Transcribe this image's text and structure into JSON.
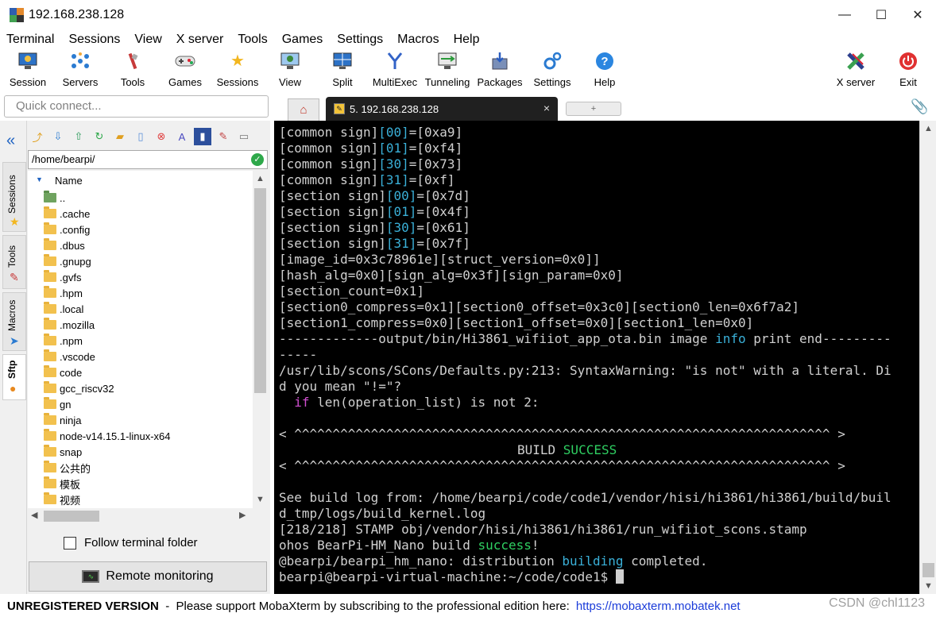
{
  "window": {
    "title": "192.168.238.128",
    "minimize": "—",
    "maximize": "☐",
    "close": "✕"
  },
  "menu": [
    "Terminal",
    "Sessions",
    "View",
    "X server",
    "Tools",
    "Games",
    "Settings",
    "Macros",
    "Help"
  ],
  "toolbar": {
    "session": "Session",
    "servers": "Servers",
    "tools": "Tools",
    "games": "Games",
    "sessions": "Sessions",
    "view": "View",
    "split": "Split",
    "multiexec": "MultiExec",
    "tunneling": "Tunneling",
    "packages": "Packages",
    "settings": "Settings",
    "help": "Help",
    "xserver": "X server",
    "exit": "Exit"
  },
  "quick_connect": {
    "placeholder": "Quick connect..."
  },
  "tabs": {
    "active_label": "5. 192.168.238.128",
    "close": "×",
    "new": "+"
  },
  "sidebar_tabs": {
    "sessions": "Sessions",
    "tools": "Tools",
    "macros": "Macros",
    "sftp": "Sftp"
  },
  "sftp": {
    "path": "/home/bearpi/",
    "column": "Name",
    "items": [
      "..",
      ".cache",
      ".config",
      ".dbus",
      ".gnupg",
      ".gvfs",
      ".hpm",
      ".local",
      ".mozilla",
      ".npm",
      ".vscode",
      "code",
      "gcc_riscv32",
      "gn",
      "ninja",
      "node-v14.15.1-linux-x64",
      "snap",
      "公共的",
      "模板",
      "视频"
    ],
    "follow_label": "Follow terminal folder",
    "remote_label": "Remote monitoring"
  },
  "terminal": {
    "lines": [
      [
        "[common sign]",
        "[00]",
        "=[0xa9]"
      ],
      [
        "[common sign]",
        "[01]",
        "=[0xf4]"
      ],
      [
        "[common sign]",
        "[30]",
        "=[0x73]"
      ],
      [
        "[common sign]",
        "[31]",
        "=[0xf]"
      ],
      [
        "[section sign]",
        "[00]",
        "=[0x7d]"
      ],
      [
        "[section sign]",
        "[01]",
        "=[0x4f]"
      ],
      [
        "[section sign]",
        "[30]",
        "=[0x61]"
      ],
      [
        "[section sign]",
        "[31]",
        "=[0x7f]"
      ]
    ],
    "plain1": "[image_id=0x3c78961e][struct_version=0x0]]",
    "plain2": "[hash_alg=0x0][sign_alg=0x3f][sign_param=0x0]",
    "plain3": "[section_count=0x1]",
    "plain4": "[section0_compress=0x1][section0_offset=0x3c0][section0_len=0x6f7a2]",
    "plain5": "[section1_compress=0x0][section1_offset=0x0][section1_len=0x0]",
    "ota_a": "-------------output/bin/Hi3861_wifiiot_app_ota.bin image ",
    "ota_info": "info",
    "ota_b": " print end---------",
    "ota_c": "-----",
    "warn1": "/usr/lib/scons/SCons/Defaults.py:213: SyntaxWarning: \"is not\" with a literal. Di",
    "warn2": "d you mean \"!=\"?",
    "warn3_if": "if",
    "warn3_rest": " len(operation_list) is not 2:",
    "banner": "< ^^^^^^^^^^^^^^^^^^^^^^^^^^^^^^^^^^^^^^^^^^^^^^^^^^^^^^^^^^^^^^^^^^^^^^ >",
    "build_a": "BUILD ",
    "build_b": "SUCCESS",
    "log1": "See build log from: /home/bearpi/code/code1/vendor/hisi/hi3861/hi3861/build/buil",
    "log2": "d_tmp/logs/build_kernel.log",
    "stamp": "[218/218] STAMP obj/vendor/hisi/hi3861/hi3861/run_wifiiot_scons.stamp",
    "ohos_a": "ohos BearPi-HM_Nano build ",
    "ohos_b": "success",
    "ohos_c": "!",
    "dist_a": "@bearpi/bearpi_hm_nano: distribution ",
    "dist_b": "building",
    "dist_c": " completed.",
    "prompt": "bearpi@bearpi-virtual-machine:~/code/code1$ "
  },
  "status": {
    "unregistered": "UNREGISTERED VERSION",
    "message": "  -  Please support MobaXterm by subscribing to the professional edition here:",
    "link": "https://mobaxterm.mobatek.net",
    "watermark": "CSDN @chl1123"
  },
  "colors": {
    "terminal_bg": "#000000",
    "cyan": "#3ab0d8",
    "green": "#2fcf62",
    "magenta": "#d14fd0"
  }
}
